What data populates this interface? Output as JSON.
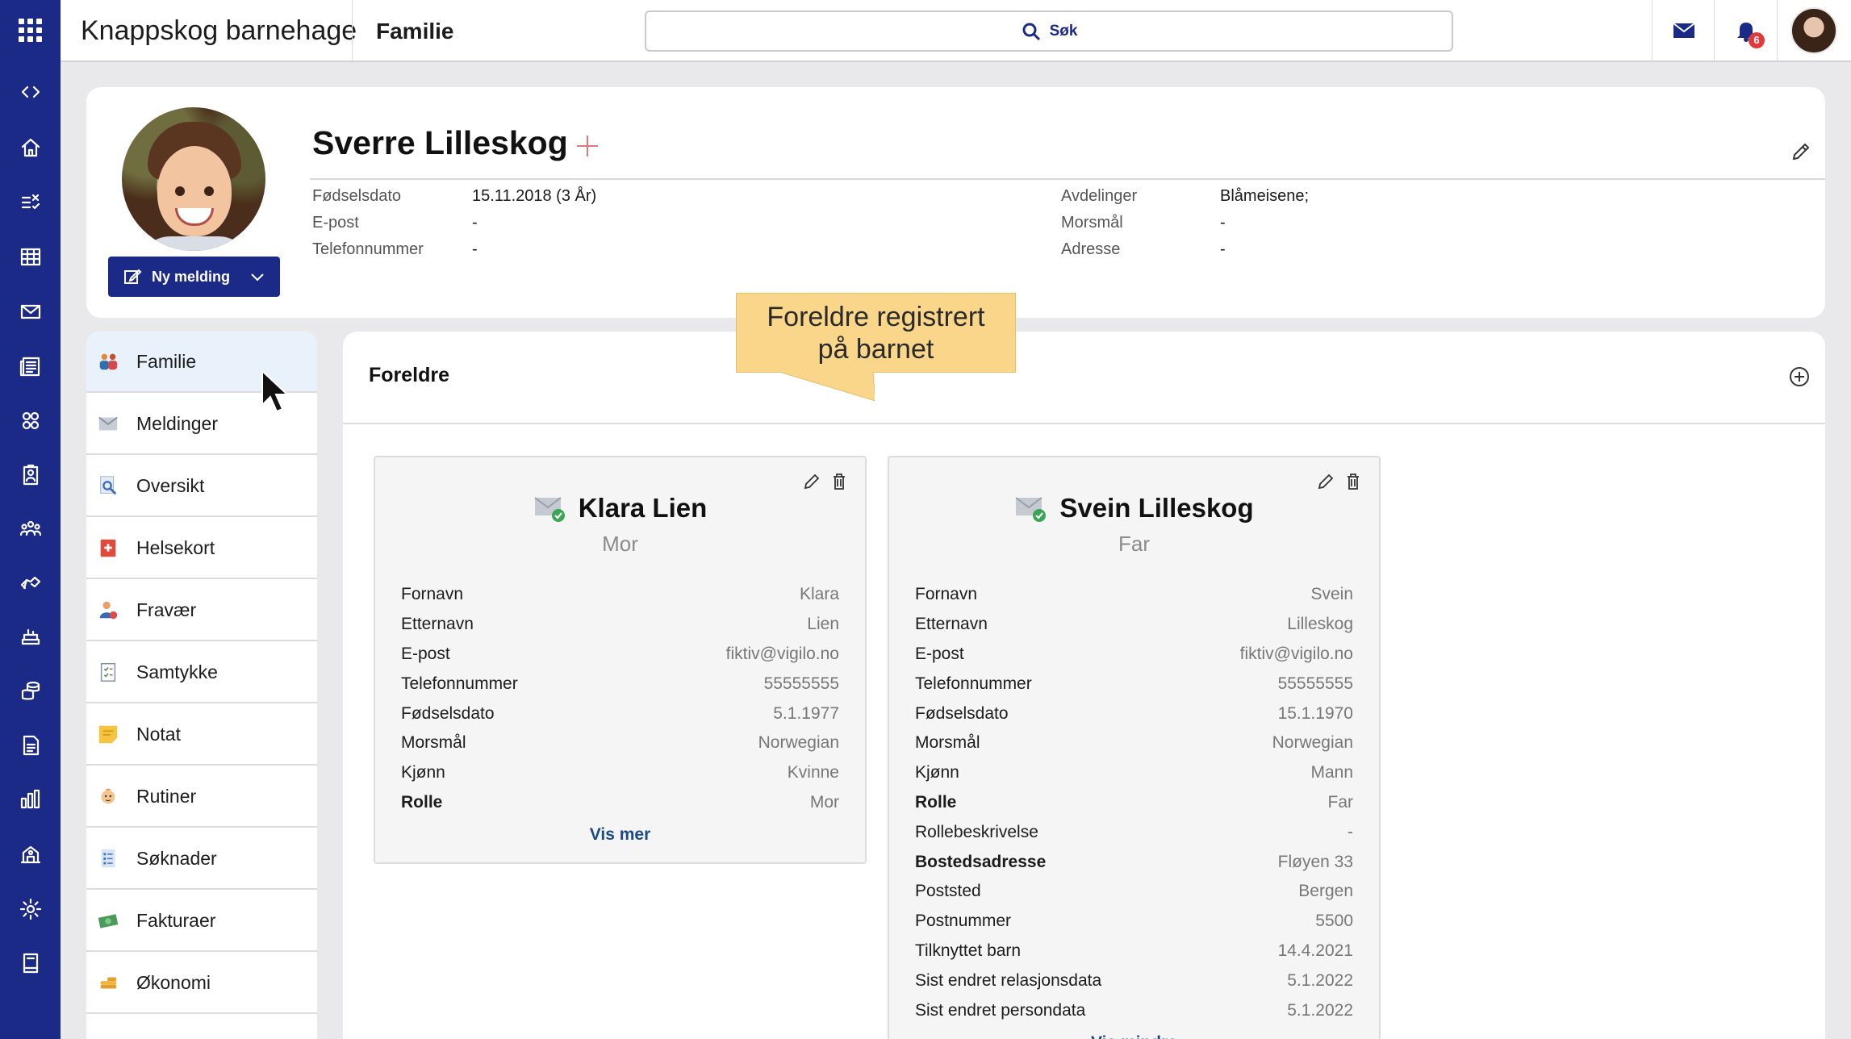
{
  "app": {
    "title": "Knappskog barnehage",
    "breadcrumb": "Familie",
    "search_label": "Søk",
    "notification_count": "6"
  },
  "rail": {
    "items": [
      "apps-grid-icon",
      "expand-collapse-icon",
      "home-icon",
      "tasks-icon",
      "calendar-icon",
      "mail-icon",
      "news-icon",
      "groups-icon",
      "clipboard-icon",
      "people-icon",
      "handshake-icon",
      "food-icon",
      "coins-icon",
      "document-icon",
      "statistics-icon",
      "organization-icon",
      "settings-icon",
      "book-icon"
    ]
  },
  "child": {
    "name": "Sverre Lilleskog",
    "new_message_label": "Ny melding",
    "left_fields": [
      {
        "label": "Fødselsdato",
        "value": "15.11.2018 (3 År)"
      },
      {
        "label": "E-post",
        "value": "-"
      },
      {
        "label": "Telefonnummer",
        "value": "-"
      }
    ],
    "right_fields": [
      {
        "label": "Avdelinger",
        "value": "Blåmeisene;"
      },
      {
        "label": "Morsmål",
        "value": "-"
      },
      {
        "label": "Adresse",
        "value": "-"
      }
    ]
  },
  "menu": {
    "items": [
      {
        "label": "Familie",
        "icon": "family-icon",
        "active": true
      },
      {
        "label": "Meldinger",
        "icon": "envelope-icon"
      },
      {
        "label": "Oversikt",
        "icon": "overview-icon"
      },
      {
        "label": "Helsekort",
        "icon": "health-card-icon"
      },
      {
        "label": "Fravær",
        "icon": "absence-icon"
      },
      {
        "label": "Samtykke",
        "icon": "consent-icon"
      },
      {
        "label": "Notat",
        "icon": "note-icon"
      },
      {
        "label": "Rutiner",
        "icon": "routines-icon"
      },
      {
        "label": "Søknader",
        "icon": "applications-icon"
      },
      {
        "label": "Fakturaer",
        "icon": "invoices-icon"
      },
      {
        "label": "Økonomi",
        "icon": "economy-icon"
      }
    ]
  },
  "tooltip": {
    "line1": "Foreldre registrert",
    "line2": "på barnet"
  },
  "parents": {
    "title": "Foreldre",
    "cards": [
      {
        "name": "Klara Lien",
        "role": "Mor",
        "fields": [
          {
            "label": "Fornavn",
            "value": "Klara"
          },
          {
            "label": "Etternavn",
            "value": "Lien"
          },
          {
            "label": "E-post",
            "value": "fiktiv@vigilo.no"
          },
          {
            "label": "Telefonnummer",
            "value": "55555555"
          },
          {
            "label": "Fødselsdato",
            "value": "5.1.1977"
          },
          {
            "label": "Morsmål",
            "value": "Norwegian"
          },
          {
            "label": "Kjønn",
            "value": "Kvinne"
          },
          {
            "label": "Rolle",
            "value": "Mor",
            "bold": true
          }
        ],
        "toggle_label": "Vis mer"
      },
      {
        "name": "Svein Lilleskog",
        "role": "Far",
        "fields": [
          {
            "label": "Fornavn",
            "value": "Svein"
          },
          {
            "label": "Etternavn",
            "value": "Lilleskog"
          },
          {
            "label": "E-post",
            "value": "fiktiv@vigilo.no"
          },
          {
            "label": "Telefonnummer",
            "value": "55555555"
          },
          {
            "label": "Fødselsdato",
            "value": "15.1.1970"
          },
          {
            "label": "Morsmål",
            "value": "Norwegian"
          },
          {
            "label": "Kjønn",
            "value": "Mann"
          },
          {
            "label": "Rolle",
            "value": "Far",
            "bold": true
          },
          {
            "label": "Rollebeskrivelse",
            "value": "-"
          },
          {
            "label": "Bostedsadresse",
            "value": "Fløyen 33",
            "bold": true
          },
          {
            "label": "Poststed",
            "value": "Bergen"
          },
          {
            "label": "Postnummer",
            "value": "5500"
          },
          {
            "label": "Tilknyttet barn",
            "value": "14.4.2021"
          },
          {
            "label": "Sist endret relasjonsdata",
            "value": "5.1.2022"
          },
          {
            "label": "Sist endret persondata",
            "value": "5.1.2022"
          }
        ],
        "toggle_label": "Vis mindre"
      }
    ]
  },
  "colors": {
    "rail": "#1b2a87",
    "accent": "#1b2a87",
    "tooltip": "#fad68a",
    "badge": "#e03a3a"
  }
}
